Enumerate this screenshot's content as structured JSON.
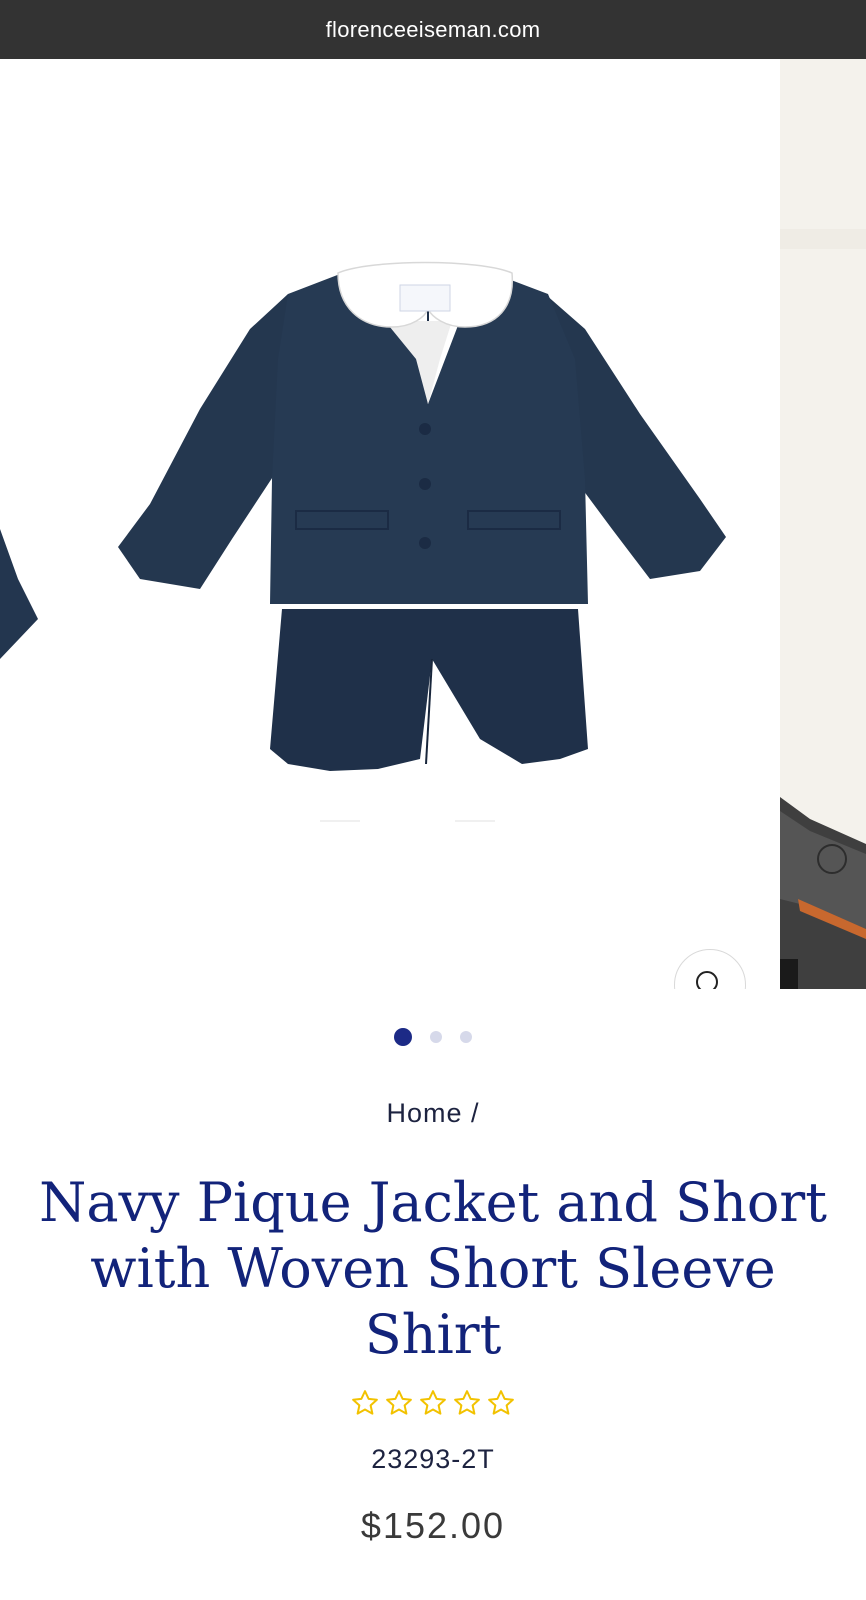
{
  "browser": {
    "url": "florenceeiseman.com"
  },
  "gallery": {
    "product_image_alt": "Navy Pique Jacket and Short with Woven Short Sleeve Shirt",
    "slide_count": 3,
    "active_slide": 1,
    "zoom_icon": "search-icon"
  },
  "breadcrumb": {
    "home_label": "Home",
    "separator": "/"
  },
  "product": {
    "title": "Navy Pique Jacket and Short with Woven Short Sleeve Shirt",
    "rating": 0,
    "rating_max": 5,
    "sku": "23293-2T",
    "price": "$152.00"
  },
  "colors": {
    "navy_title": "#12237a",
    "star_outline": "#f2c200",
    "dot_active": "#1c2a86",
    "dot_inactive": "#d6d9ea",
    "garment_navy": "#23364f"
  }
}
